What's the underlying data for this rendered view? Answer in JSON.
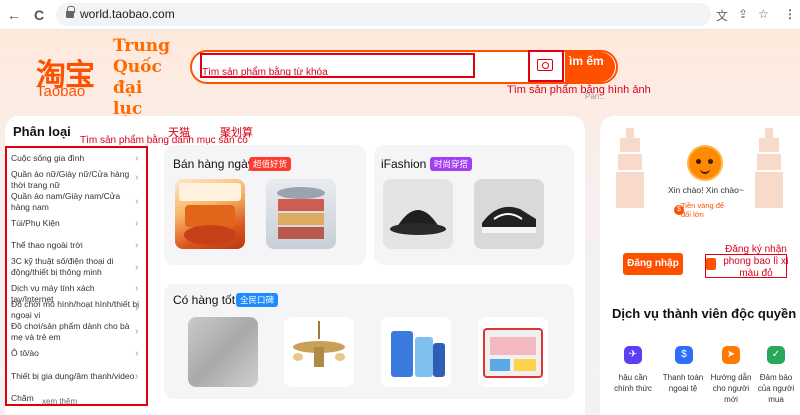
{
  "browser": {
    "url": "world.taobao.com",
    "back_icon": "←",
    "forward_icon": "→",
    "reload_icon": "C",
    "translate_icon": "文",
    "share_icon": "⇪",
    "star_icon": "☆",
    "menu_icon": "⋮"
  },
  "header": {
    "logo_cn": "淘宝",
    "logo_en": "Taobao",
    "site_region": "Trung Quốc đại lục",
    "search_placeholder": "Tìm sản phẩm bằng từ khóa",
    "search_button": "ìm ếm",
    "image_search_label": "Tìm sản phẩm bằng hình ảnh",
    "hint_small": "Pán..."
  },
  "categories": {
    "title": "Phân loại",
    "annotation_tmall": "天猫",
    "annotation_juhuasuan": "聚划算",
    "annotation_caption": "Tìm sản phẩm bằng danh mục sẵn có",
    "items": [
      "Cuộc sống gia đình",
      "Quần áo nữ/Giày nữ/Cửa hàng thời trang nữ",
      "Quần áo nam/Giày nam/Cửa hàng nam",
      "Túi/Phụ Kiện",
      "Thể thao ngoài trời",
      "3C kỹ thuật số/điện thoại di động/thiết bị thông minh",
      "Dịch vụ máy tính xách tay/Internet",
      "Đồ chơi mô hình/hoạt hình/thiết bị ngoại vi",
      "Đồ chơi/sản phẩm dành cho bà mẹ và trẻ em",
      "Ô tô/ào",
      "Thiết bị gia dụng/âm thanh/video",
      "Chăm"
    ],
    "see_more": "xem thêm"
  },
  "sections": {
    "daily": {
      "title": "Bán hàng ngày",
      "badge": "超值好货"
    },
    "ifashion": {
      "title": "iFashion",
      "badge": "时尚穿搭"
    },
    "goods": {
      "title": "Có hàng tốt",
      "badge": "全民口碑"
    }
  },
  "user": {
    "greeting": "Xin chào! Xin chào~",
    "coin_text": "Tiền vàng để đổi lớn",
    "login_button": "Đăng nhập",
    "register_text": "Đăng ký nhận phong bao lì xì màu đỏ"
  },
  "services": {
    "title": "Dịch vụ thành viên độc quyền",
    "items": [
      {
        "label": "hậu cần chính thức",
        "color": "#5b3ff5",
        "icon": "✈"
      },
      {
        "label": "Thanh toán ngoại tệ",
        "color": "#2f6ef7",
        "icon": "$"
      },
      {
        "label": "Hướng dẫn cho người mới",
        "color": "#ff7a00",
        "icon": "➤"
      },
      {
        "label": "Đảm bảo của người mua",
        "color": "#27a85a",
        "icon": "✓"
      }
    ]
  },
  "colors": {
    "brand": "#ff5000",
    "annotation": "#d9001b"
  }
}
